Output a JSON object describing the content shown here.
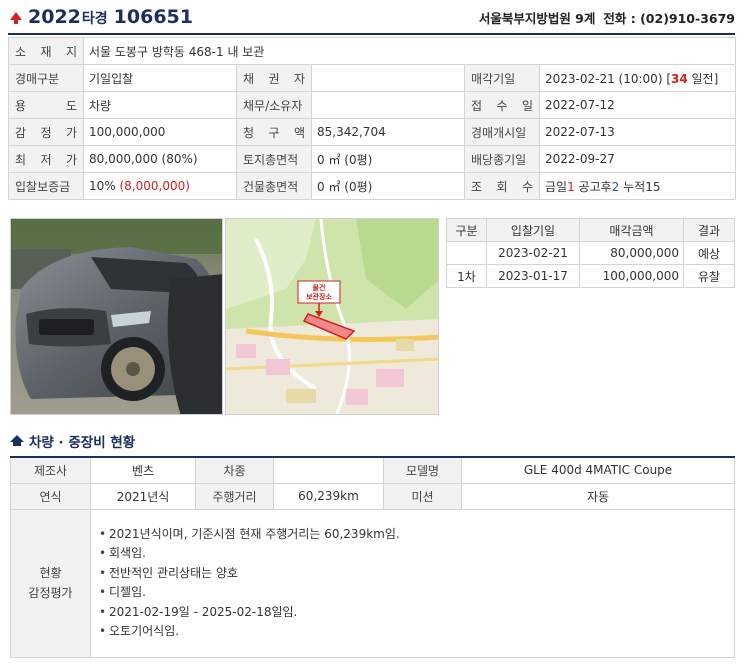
{
  "header": {
    "case_year": "2022",
    "case_type": "타경",
    "case_number": "106651",
    "court": "서울북부지방법원 9계",
    "phone_label": "전화 : (02)910-3679"
  },
  "info": {
    "location_label": "소 재 지",
    "location": "서울 도봉구 방학동 468-1 내 보관",
    "auction_type_label": "경매구분",
    "auction_type": "기일입찰",
    "creditor_label": "채 권 자",
    "creditor": "",
    "sale_date_label": "매각기일",
    "sale_date": "2023-02-21 (10:00) [",
    "sale_days": "34",
    "sale_days_suffix": " 일전]",
    "usage_label": "용 도",
    "usage": "차량",
    "debtor_label": "채무/소유자",
    "debtor": "",
    "received_label": "접 수 일",
    "received": "2022-07-12",
    "appraisal_label": "감 정 가",
    "appraisal": "100,000,000",
    "claim_label": "청 구 액",
    "claim": "85,342,704",
    "start_label": "경매개시일",
    "start": "2022-07-13",
    "minimum_label": "최 저 가",
    "minimum": "80,000,000 (80%)",
    "land_area_label": "토지총면적",
    "land_area": "0 ㎡ (0평)",
    "dividend_label": "배당종기일",
    "dividend": "2022-09-27",
    "deposit_label": "입찰보증금",
    "deposit": "10% ",
    "deposit_amount": "(8,000,000)",
    "building_area_label": "건물총면적",
    "building_area": "0 ㎡ (0평)",
    "views_label": "조 회 수",
    "views_today_label": "금일",
    "views_today": "1",
    "views_after_label": " 공고후",
    "views_after": "2",
    "views_total_label": " 누적",
    "views_total": "15"
  },
  "map": {
    "marker_label_1": "물건",
    "marker_label_2": "보관장소"
  },
  "history": {
    "headers": [
      "구분",
      "입찰기일",
      "매각금액",
      "결과"
    ],
    "rows": [
      {
        "round": "",
        "date": "2023-02-21",
        "amount": "80,000,000",
        "result": "예상"
      },
      {
        "round": "1차",
        "date": "2023-01-17",
        "amount": "100,000,000",
        "result": "유찰"
      }
    ]
  },
  "section_title": "차량 · 중장비 현황",
  "vehicle": {
    "maker_label": "제조사",
    "maker": "벤츠",
    "type_label": "차종",
    "type": "",
    "model_label": "모델명",
    "model": "GLE 400d 4MATIC Coupe",
    "year_label": "연식",
    "year": "2021년식",
    "mileage_label": "주행거리",
    "mileage": "60,239km",
    "transmission_label": "미션",
    "transmission": "자동",
    "status_label_1": "현황",
    "status_label_2": "감정평가",
    "remarks": [
      "2021년식이며, 기준시점 현재 주행거리는 60,239km임.",
      "회색임.",
      "전반적인 관리상태는 양호",
      "디젤임.",
      "2021-02-19일 - 2025-02-18일임.",
      "오토기어식임."
    ]
  }
}
